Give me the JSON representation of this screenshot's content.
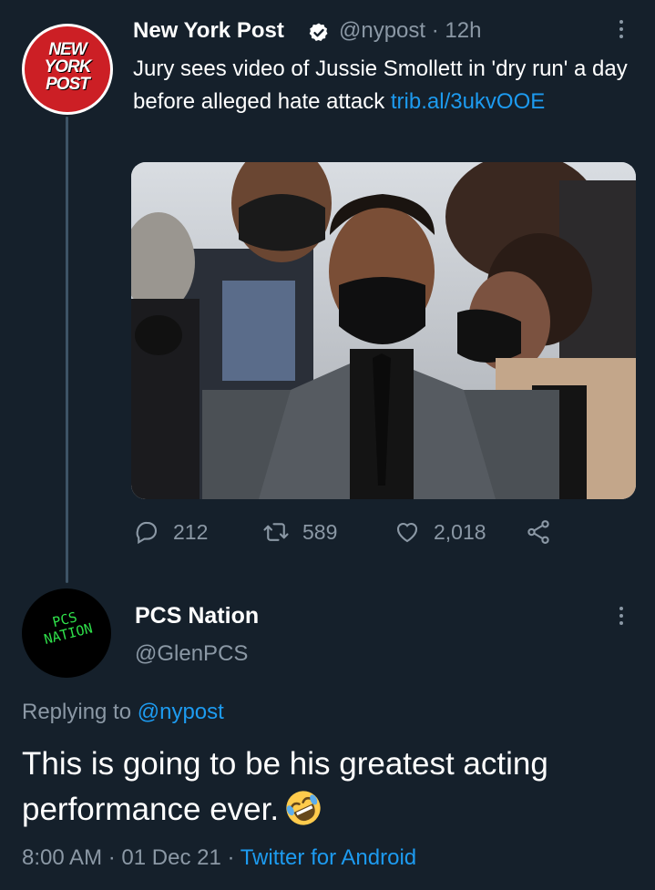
{
  "original_tweet": {
    "author_name": "New York Post",
    "handle": "@nypost",
    "separator": "·",
    "time": "12h",
    "avatar_text": [
      "NEW",
      "YORK",
      "POST"
    ],
    "text": "Jury sees video of Jussie Smollett in 'dry run' a day before alleged hate attack ",
    "link": "trib.al/3ukvOOE",
    "image_description": "photo-people-masks",
    "stats": {
      "replies": "212",
      "retweets": "589",
      "likes": "2,018"
    }
  },
  "reply_tweet": {
    "author_name": "PCS Nation",
    "handle": "@GlenPCS",
    "avatar_text": [
      "PCS",
      "NATION"
    ],
    "replying_label": "Replying to ",
    "replying_to": "@nypost",
    "text": "This is going to be his greatest acting performance ever.",
    "emoji": "rolling-on-floor-laughing",
    "time": "8:00 AM",
    "date": "01 Dec 21",
    "dot": "·",
    "source": "Twitter for Android"
  },
  "colors": {
    "background": "#15202b",
    "accent": "#1d9bf0",
    "secondary_text": "#8b98a5",
    "pcs_green": "#2fe04a",
    "nyp_red": "#cc1f25"
  }
}
